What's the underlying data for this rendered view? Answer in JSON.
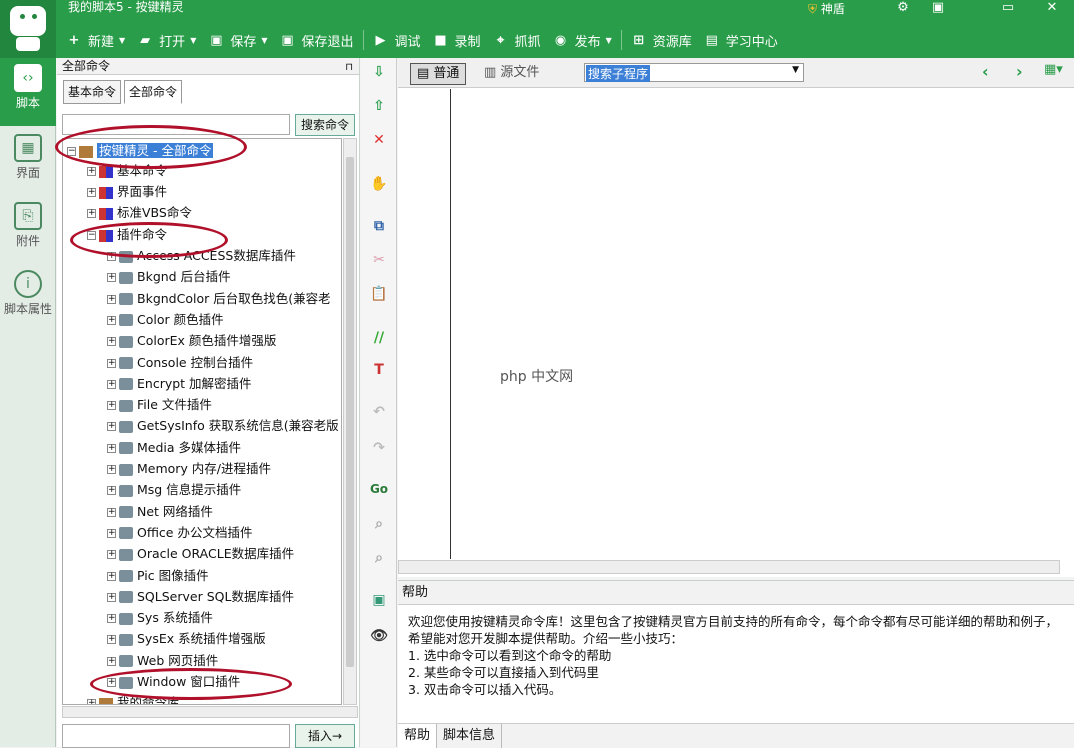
{
  "window": {
    "title": "我的脚本5 - 按键精灵",
    "user": "神盾"
  },
  "toolbar": {
    "new": "新建",
    "open": "打开",
    "save": "保存",
    "save_exit": "保存退出",
    "debug": "调试",
    "record": "录制",
    "capture": "抓抓",
    "publish": "发布",
    "resources": "资源库",
    "learn": "学习中心"
  },
  "sidebar": {
    "script": "脚本",
    "ui": "界面",
    "attachment": "附件",
    "properties": "脚本属性"
  },
  "panel": {
    "header": "全部命令",
    "tabs": [
      "基本命令",
      "全部命令"
    ],
    "search_button": "搜索命令",
    "insert_button": "插入→",
    "tree": {
      "root": "按键精灵 - 全部命令",
      "categories": [
        "基本命令",
        "界面事件",
        "标准VBS命令",
        "插件命令"
      ],
      "plugins": [
        "Access ACCESS数据库插件",
        "Bkgnd 后台插件",
        "BkgndColor 后台取色找色(兼容老",
        "Color 颜色插件",
        "ColorEx 颜色插件增强版",
        "Console 控制台插件",
        "Encrypt 加解密插件",
        "File 文件插件",
        "GetSysInfo 获取系统信息(兼容老版",
        "Media 多媒体插件",
        "Memory 内存/进程插件",
        "Msg 信息提示插件",
        "Net 网络插件",
        "Office 办公文档插件",
        "Oracle ORACLE数据库插件",
        "Pic 图像插件",
        "SQLServer SQL数据库插件",
        "Sys 系统插件",
        "SysEx 系统插件增强版",
        "Web 网页插件",
        "Window 窗口插件"
      ],
      "last": "我的命令库"
    }
  },
  "editor": {
    "tab_normal": "普通",
    "tab_source": "源文件",
    "sub_selector": "搜索子程序"
  },
  "help": {
    "header": "帮助",
    "intro": "欢迎您使用按键精灵命令库！这里包含了按键精灵官方目前支持的所有命令，每个命令都有尽可能详细的帮助和例子，希望能对您开发脚本提供帮助。介绍一些小技巧：",
    "tips": [
      "1. 选中命令可以看到这个命令的帮助",
      "2. 某些命令可以直接插入到代码里",
      "3. 双击命令可以插入代码。"
    ],
    "tabs": [
      "帮助",
      "脚本信息"
    ]
  },
  "watermark": "php 中文网",
  "colors": {
    "brand": "#2a9d4a",
    "selection": "#3b7fd6",
    "annotation": "#b0102a"
  }
}
